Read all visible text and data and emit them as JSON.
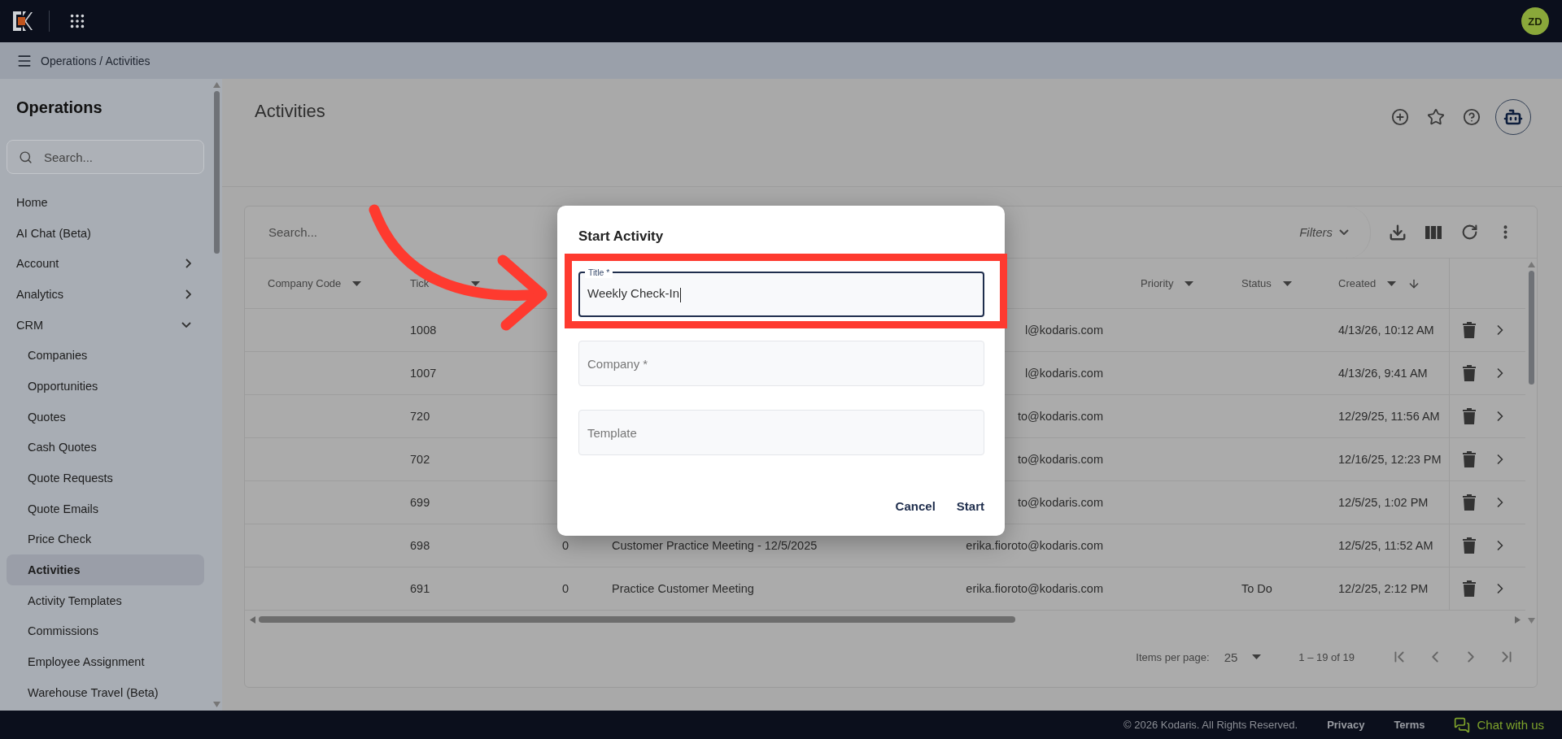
{
  "top_bar": {
    "avatar": "ZD"
  },
  "breadcrumb": "Operations / Activities",
  "sidebar": {
    "title": "Operations",
    "search": {
      "placeholder": "Search..."
    },
    "items": [
      {
        "label": "Home",
        "selected": false
      },
      {
        "label": "AI Chat (Beta)",
        "selected": false
      },
      {
        "label": "Account",
        "selected": false,
        "expanded": false
      },
      {
        "label": "Analytics",
        "selected": false,
        "expanded": false
      },
      {
        "label": "CRM",
        "selected": false,
        "expanded": true,
        "children": [
          {
            "label": "Companies",
            "selected": false
          },
          {
            "label": "Opportunities",
            "selected": false
          },
          {
            "label": "Quotes",
            "selected": false
          },
          {
            "label": "Cash Quotes",
            "selected": false
          },
          {
            "label": "Quote Requests",
            "selected": false
          },
          {
            "label": "Quote Emails",
            "selected": false
          },
          {
            "label": "Price Check",
            "selected": false
          },
          {
            "label": "Activities",
            "selected": true
          },
          {
            "label": "Activity Templates",
            "selected": false
          },
          {
            "label": "Commissions",
            "selected": false
          },
          {
            "label": "Employee Assignment",
            "selected": false
          },
          {
            "label": "Warehouse Travel (Beta)",
            "selected": false
          }
        ]
      }
    ]
  },
  "page": {
    "title": "Activities"
  },
  "table": {
    "search": {
      "placeholder": "Search..."
    },
    "filters": "Filters",
    "columns": [
      {
        "label": "Company Code",
        "filter": true
      },
      {
        "label": "Tick",
        "filter": true
      },
      {
        "filter": false
      },
      {
        "label": "Priority",
        "filter": true
      },
      {
        "label": "Status",
        "filter": true
      },
      {
        "label": "Created",
        "filter": true,
        "sorted": true
      }
    ],
    "rows": [
      {
        "ticket": "1008",
        "email": "l@kodaris.com",
        "created": "4/13/26, 10:12 AM"
      },
      {
        "ticket": "1007",
        "email": "l@kodaris.com",
        "created": "4/13/26, 9:41 AM"
      },
      {
        "ticket": "720",
        "email": "to@kodaris.com",
        "created": "12/29/25, 11:56 AM"
      },
      {
        "ticket": "702",
        "email": "to@kodaris.com",
        "created": "12/16/25, 12:23 PM"
      },
      {
        "ticket": "699",
        "email": "to@kodaris.com",
        "created": "12/5/25, 1:02 PM"
      },
      {
        "ticket": "698",
        "column_3": "0",
        "title": "Customer Practice Meeting - 12/5/2025",
        "email": "erika.fioroto@kodaris.com",
        "created": "12/5/25, 11:52 AM"
      },
      {
        "ticket": "691",
        "column_3": "0",
        "title": "Practice Customer Meeting",
        "email": "erika.fioroto@kodaris.com",
        "status": "To Do",
        "created": "12/2/25, 2:12 PM"
      }
    ],
    "pager": {
      "label": "Items per page:",
      "size": "25",
      "range": "1 – 19 of 19"
    }
  },
  "dialog": {
    "title": "Start Activity",
    "fields": [
      {
        "label": "Title *",
        "value": "Weekly Check-In",
        "focused": true,
        "highlighted": true
      },
      {
        "placeholder": "Company *",
        "focused": false,
        "highlighted": false
      },
      {
        "placeholder": "Template",
        "focused": false,
        "highlighted": false
      }
    ],
    "buttons": [
      "Cancel",
      "Start"
    ]
  },
  "annotation": {
    "arrow": true
  },
  "footer": {
    "copyright": "© 2026 Kodaris. All Rights Reserved.",
    "links": [
      "Privacy",
      "Terms"
    ],
    "chat": "Chat with us"
  }
}
